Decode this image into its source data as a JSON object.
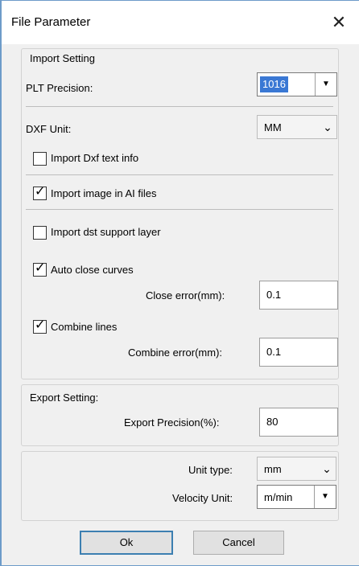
{
  "window": {
    "title": "File Parameter",
    "close_icon": "close-icon"
  },
  "import": {
    "group_label": "Import Setting",
    "plt_label": "PLT Precision:",
    "plt_value": "1016",
    "dxf_label": "DXF Unit:",
    "dxf_value": "MM",
    "checks": [
      {
        "label": "Import Dxf text info",
        "checked": false
      },
      {
        "label": "Import image in AI files",
        "checked": true
      },
      {
        "label": "Import dst support layer",
        "checked": false
      },
      {
        "label": "Auto close curves",
        "checked": true
      },
      {
        "label": "Combine lines",
        "checked": true
      }
    ],
    "close_err_label": "Close error(mm):",
    "close_err_value": "0.1",
    "combine_err_label": "Combine error(mm):",
    "combine_err_value": "0.1"
  },
  "export": {
    "group_label": "Export Setting:",
    "precision_label": "Export Precision(%):",
    "precision_value": "80"
  },
  "units": {
    "unit_type_label": "Unit type:",
    "unit_type_value": "mm",
    "velocity_label": "Velocity Unit:",
    "velocity_value": "m/min"
  },
  "buttons": {
    "ok": "Ok",
    "cancel": "Cancel"
  },
  "colors": {
    "accent": "#3c7fb1",
    "selection": "#3a78d4"
  }
}
